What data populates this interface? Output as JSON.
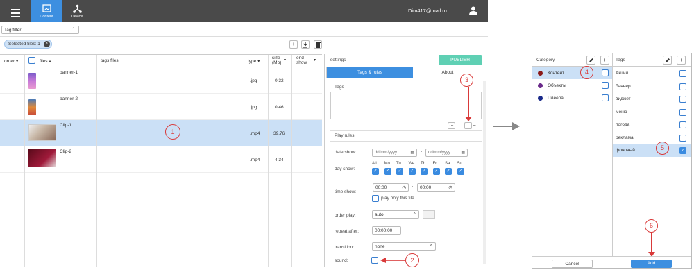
{
  "topbar": {
    "tabs": [
      {
        "label": "Content"
      },
      {
        "label": "Device"
      }
    ],
    "user_email": "Dim417@mail.ru"
  },
  "filter": {
    "tag_filter_label": "Tag filter",
    "selected_files": "Selected files: 1"
  },
  "table": {
    "headers": {
      "order": "order",
      "files": "files",
      "tags": "tags files",
      "type": "type",
      "size": "size (Mb)",
      "end": "end show"
    },
    "rows": [
      {
        "name": "banner-1",
        "type": ".jpg",
        "size": "0.32"
      },
      {
        "name": "banner-2",
        "type": ".jpg",
        "size": "0.46"
      },
      {
        "name": "Clip-1",
        "type": ".mp4",
        "size": "39.76"
      },
      {
        "name": "Clip-2",
        "type": ".mp4",
        "size": "4.34"
      }
    ]
  },
  "settings": {
    "title": "settings",
    "publish": "PUBLISH",
    "tab_tags": "Tags & rules",
    "tab_about": "About",
    "tags_label": "Tags",
    "play_rules": "Play rules",
    "date_show": "date show:",
    "date_placeholder": "dd/mm/yyyy",
    "day_show": "day show:",
    "days": [
      "All",
      "Mo",
      "Tu",
      "We",
      "Th",
      "Fr",
      "Sa",
      "Su"
    ],
    "time_show": "time show:",
    "time_from": "00:00",
    "time_to": "00:00",
    "play_only": "play only this file",
    "order_play": "order play:",
    "order_value": "auto",
    "repeat_after": "repeat after:",
    "repeat_value": "00:00:00",
    "transition": "transition:",
    "transition_value": "none",
    "sound": "sound:"
  },
  "dialog": {
    "category_title": "Category",
    "tags_title": "Tags",
    "categories": [
      {
        "name": "Контент",
        "color": "#8b1a1a"
      },
      {
        "name": "Объекты",
        "color": "#6a2a8a"
      },
      {
        "name": "Плеера",
        "color": "#1a2a8a"
      }
    ],
    "tags": [
      "Акции",
      "баннер",
      "виджет",
      "меню",
      "погода",
      "реклама",
      "фоновый"
    ],
    "cancel": "Cancel",
    "add": "Add"
  },
  "callouts": [
    "1",
    "2",
    "3",
    "4",
    "5",
    "6"
  ],
  "colors": {
    "accent": "#3d8fe0",
    "publish": "#5fd0b4",
    "callout": "#d93a3a",
    "topbar": "#4a4a4a"
  }
}
